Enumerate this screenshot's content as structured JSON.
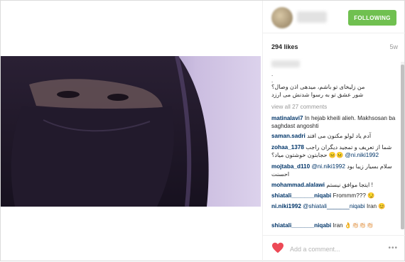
{
  "post": {
    "follow_label": "FOLLOWING",
    "likes": "294 likes",
    "age": "5w",
    "caption_dot1": ".",
    "caption_dot2": ".",
    "caption_line1": "من زلیخای تو باشم، میدهی اذن وصال؟",
    "caption_line2": "شور عشق تو به رسوا شدنش می ارزد",
    "view_all": "view all 27 comments"
  },
  "comments": [
    {
      "user": "matinalavi7",
      "text": "In hejab kheili alieh. Makhsosan ba saghdast angoshti"
    },
    {
      "user": "saman.sadri",
      "text": "آدم یاد لولو مکنون می افتد"
    },
    {
      "user": "zohaa_1378",
      "text": "شما از تعریف و تمجید دیگران راجب حجابتون خوشتون میاد؟",
      "mention": "@ni.niki1992",
      "emoji": "😐😐"
    },
    {
      "user": "mojtaba_d110",
      "mention": "@ni.niki1992",
      "text": "سلام بسیار زیبا بود احسنت"
    },
    {
      "user": "mohammad.alalawi",
      "text": "ایتجا موافق نیستم !"
    },
    {
      "user": "shiatali_______niqabi",
      "text": "Frommm???",
      "emoji": "😏"
    },
    {
      "user": "ni.niki1992",
      "mention": "@shiatali_______niqabi",
      "text": "Iran",
      "emoji": "😊"
    },
    {
      "user": "shiatali_______niqabi",
      "text": "Iran",
      "emoji": "👌👏🏻👏🏻👏🏻"
    }
  ],
  "footer": {
    "placeholder": "Add a comment...",
    "more": "•••"
  },
  "colors": {
    "follow_green": "#70c050",
    "heart_red": "#ed4956",
    "username_blue": "#003569"
  }
}
